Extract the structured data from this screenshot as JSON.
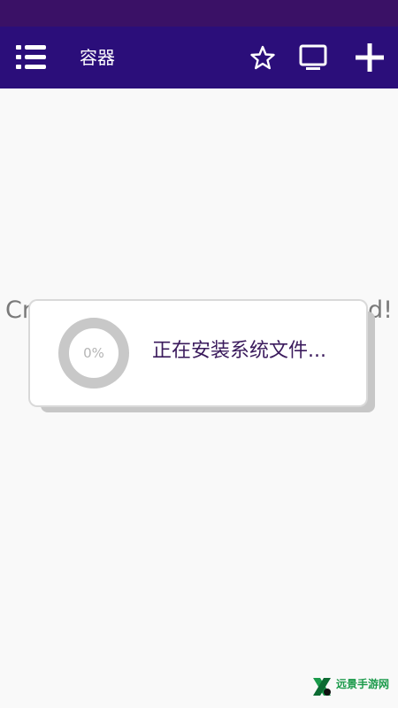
{
  "app_bar": {
    "title": "容器",
    "icons": [
      "menu-list-icon",
      "star-icon",
      "monitor-icon",
      "plus-icon"
    ]
  },
  "background_message": {
    "left_fragment": "Cr",
    "right_fragment": "d!"
  },
  "dialog": {
    "progress": "0%",
    "message": "正在安装系统文件..."
  },
  "watermark": {
    "text": "远景手游网"
  },
  "colors": {
    "status_bar": "#3a1166",
    "app_bar": "#2b0e7a",
    "background": "#f9f9f9",
    "dialog_text": "#3a1a5c",
    "progress_ring": "#c8c8c8"
  }
}
